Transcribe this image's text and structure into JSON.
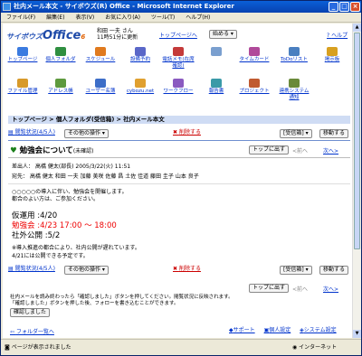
{
  "window": {
    "title": "社内メール本文 - サイボウズ(R) Office - Microsoft Internet Explorer"
  },
  "menu": [
    "ファイル(F)",
    "編集(E)",
    "表示(V)",
    "お気に入り(A)",
    "ツール(T)",
    "ヘルプ(H)"
  ],
  "header": {
    "logo": "サイボウズ",
    "logo_big": "Office",
    "logo_ver": "6",
    "user_name": "和田 一夫 さん",
    "user_time": "11時51分に更新",
    "top_link": "トップページへ",
    "start_btn": "始める",
    "help": "ヘルプ"
  },
  "apps": [
    {
      "label": "トップページ",
      "color": "#3b7be0"
    },
    {
      "label": "個人フォルダ",
      "color": "#2f8f40"
    },
    {
      "label": "スケジュール",
      "color": "#e07a1e"
    },
    {
      "label": "設備予約",
      "color": "#5a67c8"
    },
    {
      "label": "電話メモ(在席確認)",
      "color": "#c43a3a"
    },
    {
      "label": "",
      "color": "#7a9fcf"
    },
    {
      "label": "タイムカード",
      "color": "#b04a9a"
    },
    {
      "label": "ToDoリスト",
      "color": "#4a7fc0"
    },
    {
      "label": "掲示板",
      "color": "#d8a020"
    },
    {
      "label": "ファイル管理",
      "color": "#d89a2a"
    },
    {
      "label": "アドレス帳",
      "color": "#5e9a3e"
    },
    {
      "label": "ユーザー名簿",
      "color": "#3d6ec8"
    },
    {
      "label": "cybozu.net",
      "color": "#e0a030"
    },
    {
      "label": "ワークフロー",
      "color": "#8a5ac0"
    },
    {
      "label": "報告書",
      "color": "#3a9aa8"
    },
    {
      "label": "プロジェクト",
      "color": "#c05a30"
    },
    {
      "label": "連携システム通知",
      "color": "#6a8a3a"
    }
  ],
  "breadcrumb": {
    "path": "トップページ > 個人フォルダ(受信箱) > 社内メール本文"
  },
  "toolbar": {
    "read_status": "閲覧状況(4/5人)",
    "other_ops": "その他の操作",
    "delete": "削除する",
    "folder": "[受信箱]",
    "move": "移動する",
    "outbox": "トップに出す",
    "prev": "<前へ",
    "next": "次へ>"
  },
  "mail": {
    "subject": "勉強会について",
    "unconfirmed": "(未確認)",
    "sender_label": "差出人：",
    "sender": "高橋 健太(部長) 2005/3/22(火) 11:51",
    "to_label": "宛先：",
    "to": "高橋 健太  和田 一夫 加藤 美咲 佐藤 昌 土佐 佳道 藤田 圭子 山本 良子",
    "body1": "○○○○○の導入に伴い、勉強会を開催します。",
    "body2": "都合のよい方は、ご参加ください。",
    "sched": [
      {
        "label": "仮運用",
        "value": ":4/20",
        "red": false
      },
      {
        "label": "勉強会",
        "value": ":4/23  17:00 〜 18:00",
        "red": true
      },
      {
        "label": "社外公開",
        "value": ":5/2",
        "red": false
      }
    ],
    "note1": "※導入推進の都合により、社内公開が遅れています。",
    "note2": "4/21には公開できる予定です。"
  },
  "confirm": {
    "text1": "社内メールを読み終わったら「確認しました」ボタンを押してください。閲覧状況に反映されます。",
    "text2": "「確認しました」ボタンを押した後、フォローを書き込むことができます。",
    "button": "確認しました"
  },
  "back": "フォルダ一覧へ",
  "footer": {
    "support": "サポート",
    "personal": "個人設定",
    "system": "システム設定"
  },
  "status": {
    "done": "ページが表示されました",
    "zone": "インターネット"
  }
}
